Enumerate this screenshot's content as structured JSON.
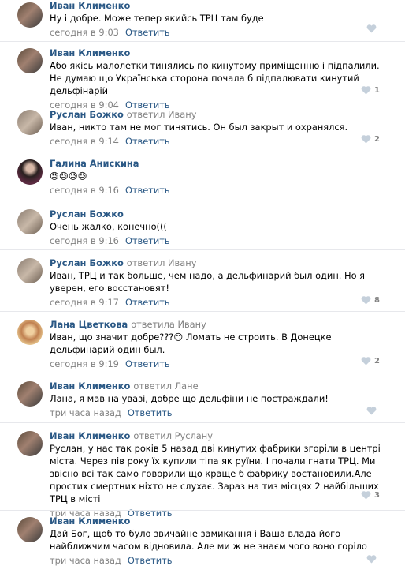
{
  "reply_label": "Ответить",
  "comments": [
    {
      "author": "Иван Клименко",
      "reply_to": "",
      "text": "Ну і добре. Може тепер якийсь ТРЦ там буде",
      "time": "сегодня в 9:03",
      "likes": ""
    },
    {
      "author": "Иван Клименко",
      "reply_to": "",
      "text": "Або якісь малолетки тинялись по кинутому приміщенню і підпалили. Не думаю що Українська сторона почала б підпалювати кинутий дельфінарій",
      "time": "сегодня в 9:04",
      "likes": "1"
    },
    {
      "author": "Руслан Божко",
      "reply_to": "ответил Ивану",
      "text": "Иван, никто там не мог тинятись. Он был закрыт и охранялся.",
      "time": "сегодня в 9:14",
      "likes": "2"
    },
    {
      "author": "Галина Анискина",
      "reply_to": "",
      "text": "😓😓😓😓",
      "time": "сегодня в 9:16",
      "likes": ""
    },
    {
      "author": "Руслан Божко",
      "reply_to": "",
      "text": "Очень жалко, конечно(((",
      "time": "сегодня в 9:16",
      "likes": ""
    },
    {
      "author": "Руслан Божко",
      "reply_to": "ответил Ивану",
      "text": "Иван, ТРЦ и так больше, чем надо, а дельфинарий был один. Но я уверен, его восстановят!",
      "time": "сегодня в 9:17",
      "likes": "8"
    },
    {
      "author": "Лана Цветкова",
      "reply_to": "ответила Ивану",
      "text": "Иван, що значит добре???😏 Ломать не строить. В Донецке дельфинарий один был.",
      "time": "сегодня в 9:19",
      "likes": "2"
    },
    {
      "author": "Иван Клименко",
      "reply_to": "ответил Лане",
      "text": "Лана, я мав на увазі, добре що дельфіни не постраждали!",
      "time": "три часа назад",
      "likes": ""
    },
    {
      "author": "Иван Клименко",
      "reply_to": "ответил Руслану",
      "text": "Руслан, у нас так років 5 назад дві кинутих фабрики згоріли в центрі міста. Через пів року їх купили тіпа як руїни. І почали гнати ТРЦ. Ми звісно всі так само говорили що краще б фабрику востановили.Але простих смертних ніхто не слухає. Зараз на тиз місцях 2 найбільших ТРЦ в місті",
      "time": "три часа назад",
      "likes": "3"
    },
    {
      "author": "Иван Клименко",
      "reply_to": "",
      "text": "Дай Бог, щоб то було звичайне замикання і Ваша влада його найближчим часом відновила. Але ми ж не знаєм чого воно горіло",
      "time": "три часа назад",
      "likes": ""
    }
  ]
}
